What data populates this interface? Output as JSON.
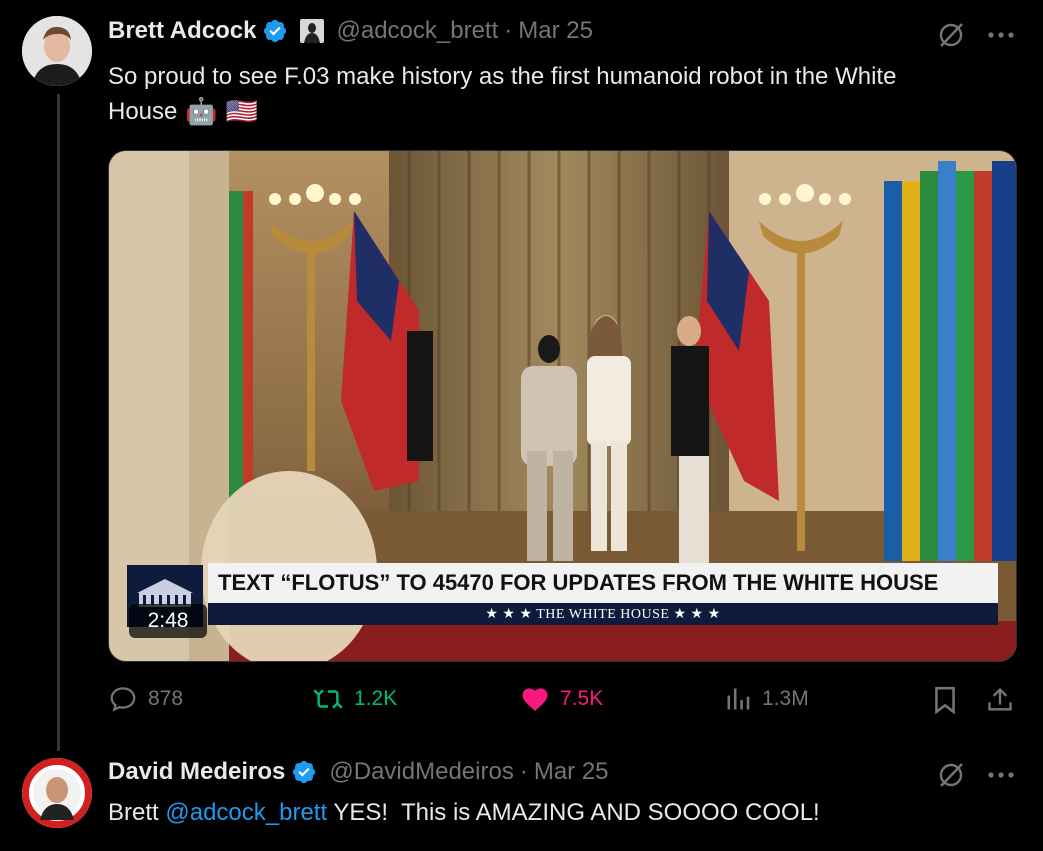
{
  "tweet1": {
    "author_name": "Brett Adcock",
    "author_handle": "@adcock_brett",
    "separator": "·",
    "date": "Mar 25",
    "text_line1": "So proud to see F.03 make history as the first humanoid robot in the White",
    "text_line2": "House",
    "emoji": [
      "🤖",
      "🇺🇸"
    ],
    "media": {
      "banner_text": "TEXT “FLOTUS” TO 45470 FOR UPDATES FROM THE WHITE HOUSE",
      "banner_sub": "★ ★ ★   THE WHITE HOUSE   ★ ★ ★",
      "duration": "2:48"
    },
    "actions": {
      "replies": "878",
      "reposts": "1.2K",
      "likes": "7.5K",
      "views": "1.3M"
    }
  },
  "tweet2": {
    "author_name": "David Medeiros",
    "author_handle": "@DavidMedeiros",
    "separator": "·",
    "date": "Mar 25",
    "text_prefix": "Brett ",
    "mention": "@adcock_brett",
    "text_suffix": " YES!  This is AMAZING AND SOOOO COOL!"
  },
  "icons": {
    "verified": "verified-badge-icon",
    "grok": "grok-icon",
    "more": "more-icon",
    "reply": "reply-icon",
    "repost": "repost-icon",
    "like": "heart-icon",
    "views": "views-icon",
    "bookmark": "bookmark-icon",
    "share": "share-icon"
  },
  "colors": {
    "background": "#000000",
    "text": "#e7e9ea",
    "secondary": "#71767b",
    "accent": "#1d9bf0",
    "repost": "#00ba7c",
    "like": "#f91880"
  }
}
